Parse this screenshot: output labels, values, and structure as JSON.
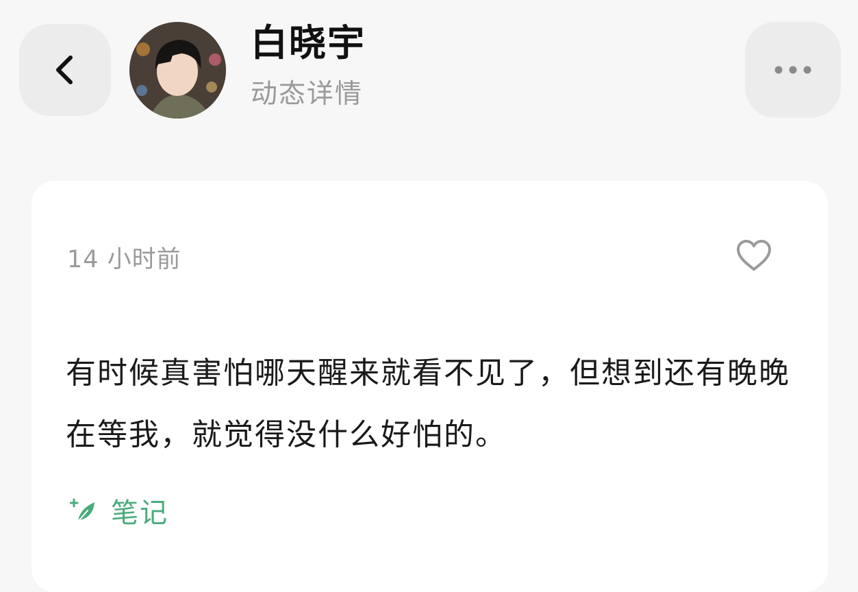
{
  "header": {
    "name": "白晓宇",
    "subtitle": "动态详情"
  },
  "post": {
    "time": "14 小时前",
    "text": "有时候真害怕哪天醒来就看不见了，但想到还有晚晚在等我，就觉得没什么好怕的。",
    "tag": "笔记",
    "liked": false
  },
  "icons": {
    "back": "chevron-left-icon",
    "more": "more-horizontal-icon",
    "like": "heart-outline-icon",
    "tag": "leaf-sparkle-icon"
  },
  "colors": {
    "background": "#f7f7f7",
    "card": "#ffffff",
    "button": "#ececec",
    "secondary_text": "#9a9a9a",
    "accent_green": "#4aab7c"
  }
}
